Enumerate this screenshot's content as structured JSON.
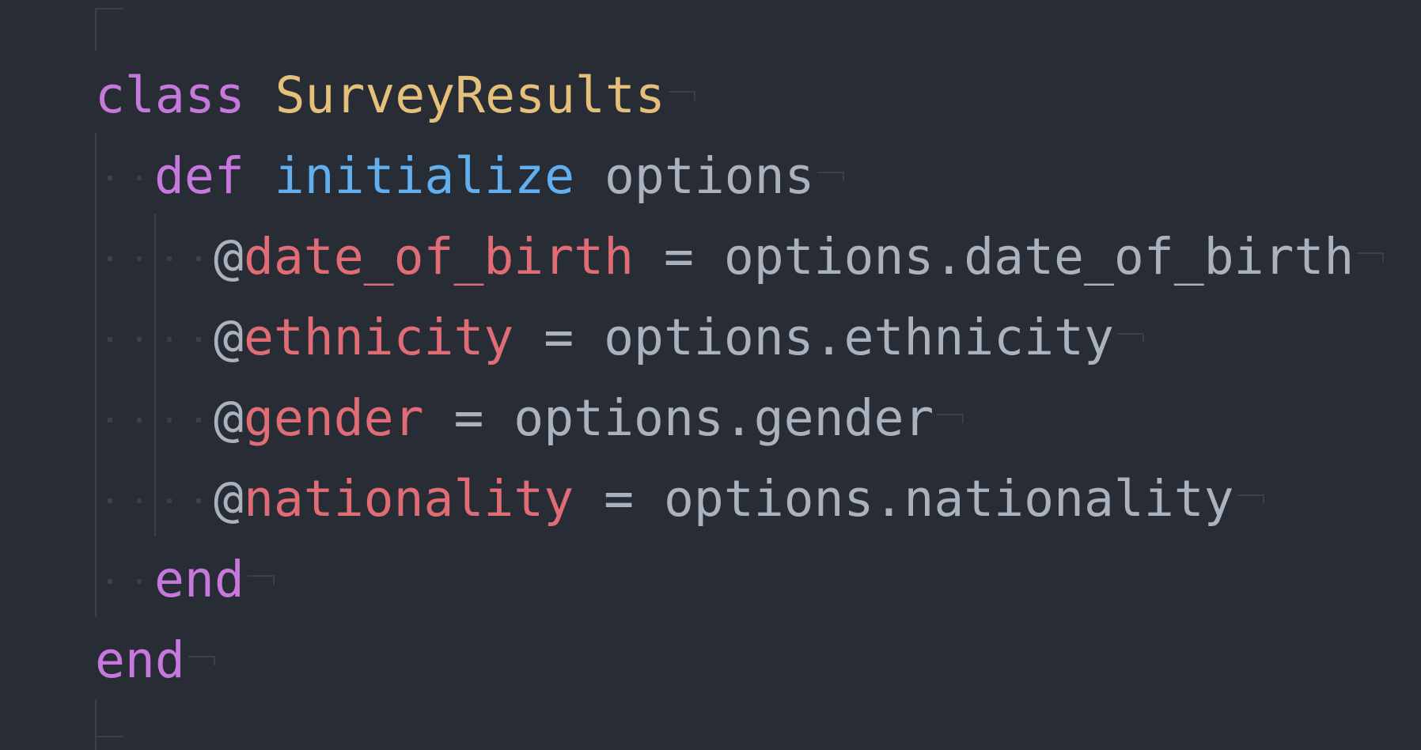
{
  "editor": {
    "theme": {
      "background": "#282c34",
      "keyword": "#c678dd",
      "class_name": "#e5c07b",
      "method_name": "#61afef",
      "instance_var": "#e06c75",
      "plain": "#abb2bf",
      "whitespace_marker": "#3b4048"
    },
    "lines": [
      {
        "indent": 0,
        "tokens": [
          {
            "t": "class",
            "k": "kw"
          },
          {
            "t": " ",
            "k": "plain"
          },
          {
            "t": "SurveyResults",
            "k": "cls"
          }
        ]
      },
      {
        "indent": 2,
        "tokens": [
          {
            "t": "def",
            "k": "kw"
          },
          {
            "t": " ",
            "k": "plain"
          },
          {
            "t": "initialize",
            "k": "fn"
          },
          {
            "t": " options",
            "k": "plain"
          }
        ]
      },
      {
        "indent": 4,
        "tokens": [
          {
            "t": "@",
            "k": "plain"
          },
          {
            "t": "date_of_birth",
            "k": "ivar"
          },
          {
            "t": " = options.date_of_birth",
            "k": "plain"
          }
        ]
      },
      {
        "indent": 4,
        "tokens": [
          {
            "t": "@",
            "k": "plain"
          },
          {
            "t": "ethnicity",
            "k": "ivar"
          },
          {
            "t": " = options.ethnicity",
            "k": "plain"
          }
        ]
      },
      {
        "indent": 4,
        "tokens": [
          {
            "t": "@",
            "k": "plain"
          },
          {
            "t": "gender",
            "k": "ivar"
          },
          {
            "t": " = options.gender",
            "k": "plain"
          }
        ]
      },
      {
        "indent": 4,
        "tokens": [
          {
            "t": "@",
            "k": "plain"
          },
          {
            "t": "nationality",
            "k": "ivar"
          },
          {
            "t": " = options.nationality",
            "k": "plain"
          }
        ]
      },
      {
        "indent": 2,
        "tokens": [
          {
            "t": "end",
            "k": "kw"
          }
        ]
      },
      {
        "indent": 0,
        "tokens": [
          {
            "t": "end",
            "k": "kw"
          }
        ]
      }
    ]
  }
}
